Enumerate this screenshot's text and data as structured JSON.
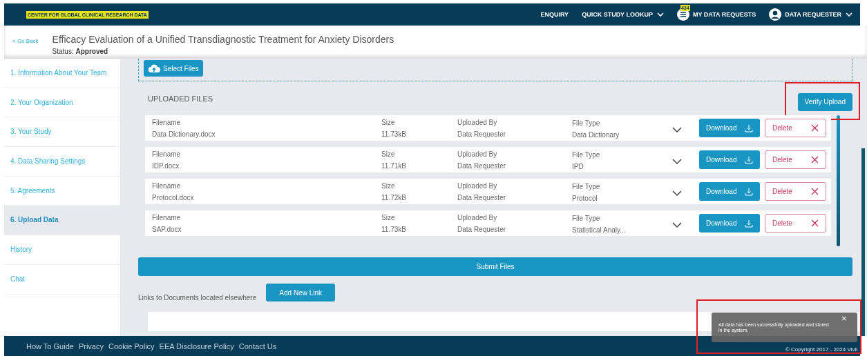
{
  "brand": {
    "tagline": "CENTER FOR GLOBAL CLINICAL RESEARCH DATA"
  },
  "nav": {
    "enquiry": "ENQUIRY",
    "quick_lookup": "QUICK STUDY LOOKUP",
    "requests": {
      "label": "MY DATA REQUESTS",
      "badge": "434"
    },
    "user": "DATA REQUESTER"
  },
  "header": {
    "back": "< Go Back",
    "title": "Efficacy Evaluation of a Unified Transdiagnostic Treatment for Anxiety Disorders",
    "status_label": "Status:",
    "status": "Approved"
  },
  "sidebar": {
    "items": [
      {
        "label": "1. Information About Your Team",
        "selected": false
      },
      {
        "label": "2. Your Organization",
        "selected": false
      },
      {
        "label": "3. Your Study",
        "selected": false
      },
      {
        "label": "4. Data Sharing Settings",
        "selected": false
      },
      {
        "label": "5. Agreements",
        "selected": false
      },
      {
        "label": "6. Upload Data",
        "selected": true
      },
      {
        "label": "History",
        "selected": false
      },
      {
        "label": "Chat",
        "selected": false
      }
    ]
  },
  "upload": {
    "select_button": "Select Files",
    "section_title": "UPLOADED FILES",
    "verify_button": {
      "label": "Verify Upload",
      "highlighted": true
    },
    "files": [
      {
        "filename_label": "Filename",
        "filename": "Data Dictionary.docx",
        "size_label": "Size",
        "size": "11.73kB",
        "uploaded_by_label": "Uploaded By",
        "uploaded_by": "Data Requester",
        "file_type_label": "File Type",
        "file_type": "Data Dictionary",
        "download": "Download",
        "delete": "Delete"
      },
      {
        "filename_label": "Filename",
        "filename": "IDP.docx",
        "size_label": "Size",
        "size": "11.71kB",
        "uploaded_by_label": "Uploaded By",
        "uploaded_by": "Data Requester",
        "file_type_label": "File Type",
        "file_type": "IPD",
        "download": "Download",
        "delete": "Delete"
      },
      {
        "filename_label": "Filename",
        "filename": "Protocol.docx",
        "size_label": "Size",
        "size": "11.72kB",
        "uploaded_by_label": "Uploaded By",
        "uploaded_by": "Data Requester",
        "file_type_label": "File Type",
        "file_type": "Protocol",
        "download": "Download",
        "delete": "Delete"
      },
      {
        "filename_label": "Filename",
        "filename": "SAP.docx",
        "size_label": "Size",
        "size": "11.73kB",
        "uploaded_by_label": "Uploaded By",
        "uploaded_by": "Data Requester",
        "file_type_label": "File Type",
        "file_type": "Statistical Analy...",
        "download": "Download",
        "delete": "Delete"
      }
    ],
    "submit_button": "Submit Files",
    "links_text": "Links to Documents located elsewhere",
    "add_link_button": "Add New Link"
  },
  "toast": {
    "message": "All data has been successfully uploaded and stored in the system.",
    "close": "×",
    "highlighted": true
  },
  "footer": {
    "links": [
      "How To Guide",
      "Privacy",
      "Cookie Policy",
      "EEA Disclosure Policy",
      "Contact Us"
    ],
    "copyright": "© Copyright 2017 - 2024 Vivli"
  }
}
